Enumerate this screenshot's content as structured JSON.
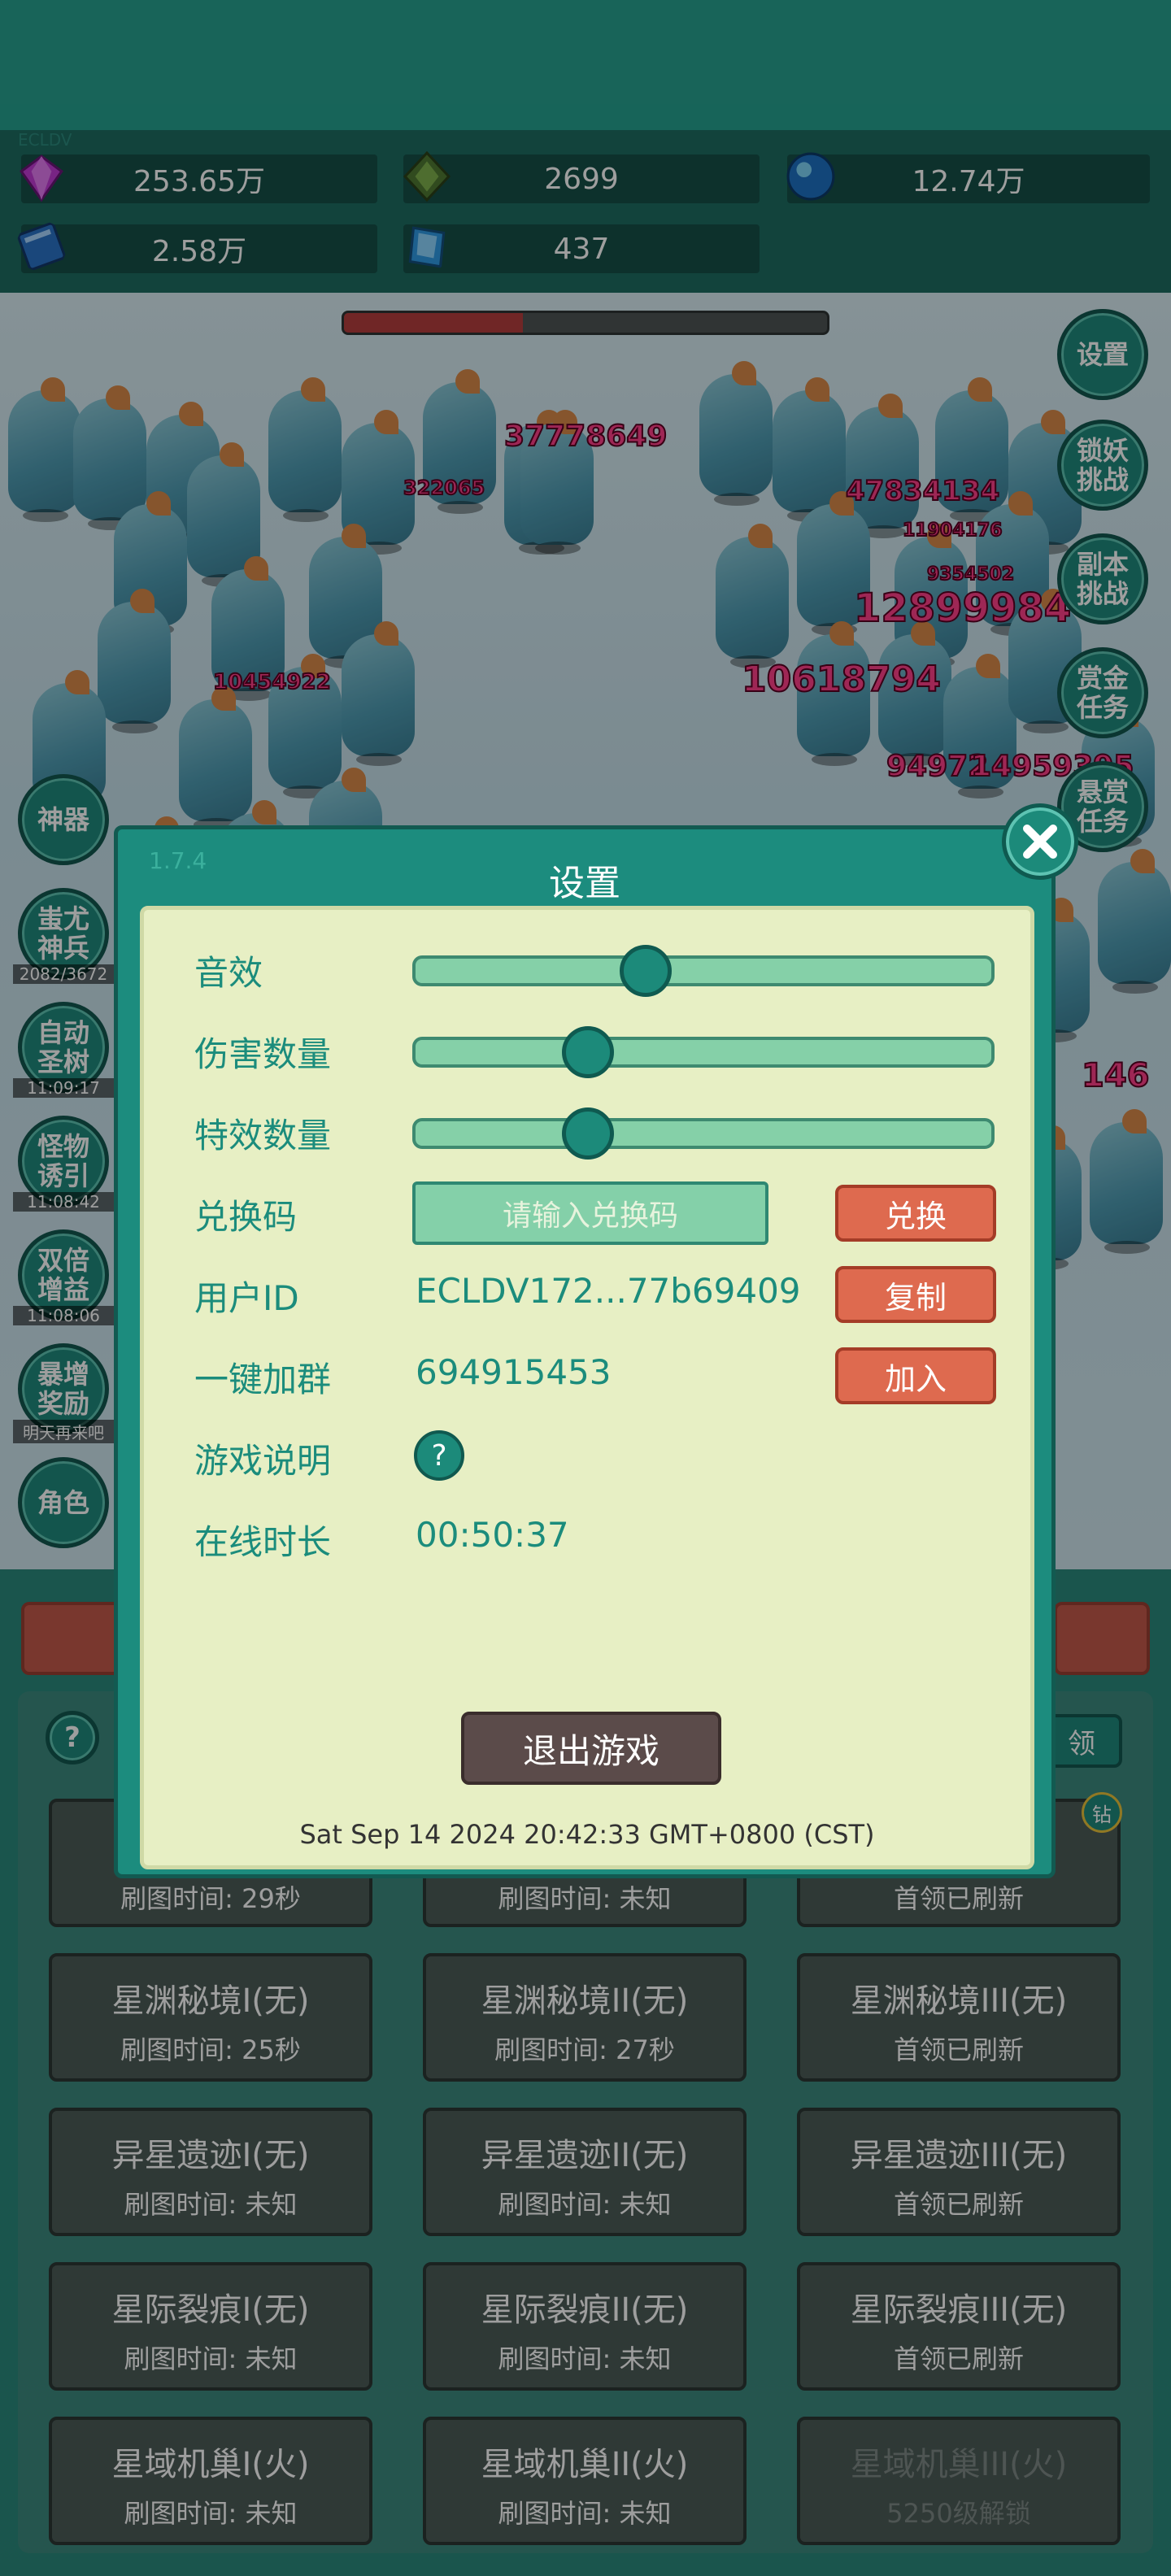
{
  "resources": [
    {
      "icon": "purple-gem-icon",
      "value": "253.65万"
    },
    {
      "icon": "green-crystal-icon",
      "value": "2699"
    },
    {
      "icon": "blue-orb-icon",
      "value": "12.74万"
    },
    {
      "icon": "blue-book-icon",
      "value": "2.58万"
    },
    {
      "icon": "blue-shard-icon",
      "value": "437"
    }
  ],
  "hud_top_label": "ECLDV",
  "boss_hp_fraction": 0.37,
  "damage_numbers": [
    "37778649",
    "322065",
    "47834134",
    "11904176",
    "9354502",
    "12899984",
    "10454922",
    "10618794",
    "94972",
    "14959395",
    "146"
  ],
  "right_menu": [
    "设置",
    "锁妖挑战",
    "副本挑战",
    "赏金任务",
    "悬赏任务"
  ],
  "left_menu": [
    {
      "label": "神器",
      "timer": ""
    },
    {
      "label": "蚩尤神兵",
      "timer": "2082/3672"
    },
    {
      "label": "自动圣树",
      "timer": "11:09:17"
    },
    {
      "label": "怪物诱引",
      "timer": "11:08:42"
    },
    {
      "label": "双倍增益",
      "timer": "11:08:06"
    },
    {
      "label": "暴增奖励",
      "timer": "明天再来吧"
    },
    {
      "label": "角色",
      "timer": ""
    }
  ],
  "list_tiles": [
    {
      "name": "星渊秘境I(无)",
      "sub": "刷图时间: 25秒",
      "locked": false
    },
    {
      "name": "星渊秘境II(无)",
      "sub": "刷图时间: 27秒",
      "locked": false
    },
    {
      "name": "星渊秘境III(无)",
      "sub": "首领已刷新",
      "locked": false
    },
    {
      "name": "异星遗迹I(无)",
      "sub": "刷图时间: 未知",
      "locked": false
    },
    {
      "name": "异星遗迹II(无)",
      "sub": "刷图时间: 未知",
      "locked": false
    },
    {
      "name": "异星遗迹III(无)",
      "sub": "首领已刷新",
      "locked": false
    },
    {
      "name": "星际裂痕I(无)",
      "sub": "刷图时间: 未知",
      "locked": false
    },
    {
      "name": "星际裂痕II(无)",
      "sub": "刷图时间: 未知",
      "locked": false
    },
    {
      "name": "星际裂痕III(无)",
      "sub": "首领已刷新",
      "locked": false
    },
    {
      "name": "星域机巢I(火)",
      "sub": "刷图时间: 未知",
      "locked": false
    },
    {
      "name": "星域机巢II(火)",
      "sub": "刷图时间: 未知",
      "locked": false
    },
    {
      "name": "星域机巢III(火)",
      "sub": "5250级解锁",
      "locked": true
    }
  ],
  "partial_tiles": [
    {
      "sub": "刷图时间: 29秒"
    },
    {
      "sub": "刷图时间: 未知"
    },
    {
      "sub": "首领已刷新"
    }
  ],
  "list_help": "?",
  "claim_partial": "领",
  "diamond_badge": "钻",
  "settings": {
    "version": "1.7.4",
    "title": "设置",
    "sound_label": "音效",
    "sound_level": 0.4,
    "damage_count_label": "伤害数量",
    "damage_count_level": 0.3,
    "effects_count_label": "特效数量",
    "effects_count_level": 0.3,
    "redeem_label": "兑换码",
    "redeem_placeholder": "请输入兑换码",
    "redeem_button": "兑换",
    "user_id_label": "用户ID",
    "user_id_value": "ECLDV172...77b69409",
    "copy_button": "复制",
    "group_label": "一键加群",
    "group_value": "694915453",
    "join_button": "加入",
    "guide_label": "游戏说明",
    "guide_icon": "?",
    "online_label": "在线时长",
    "online_value": "00:50:37",
    "exit_button": "退出游戏",
    "datetime": "Sat Sep 14 2024 20:42:33 GMT+0800 (CST)"
  }
}
